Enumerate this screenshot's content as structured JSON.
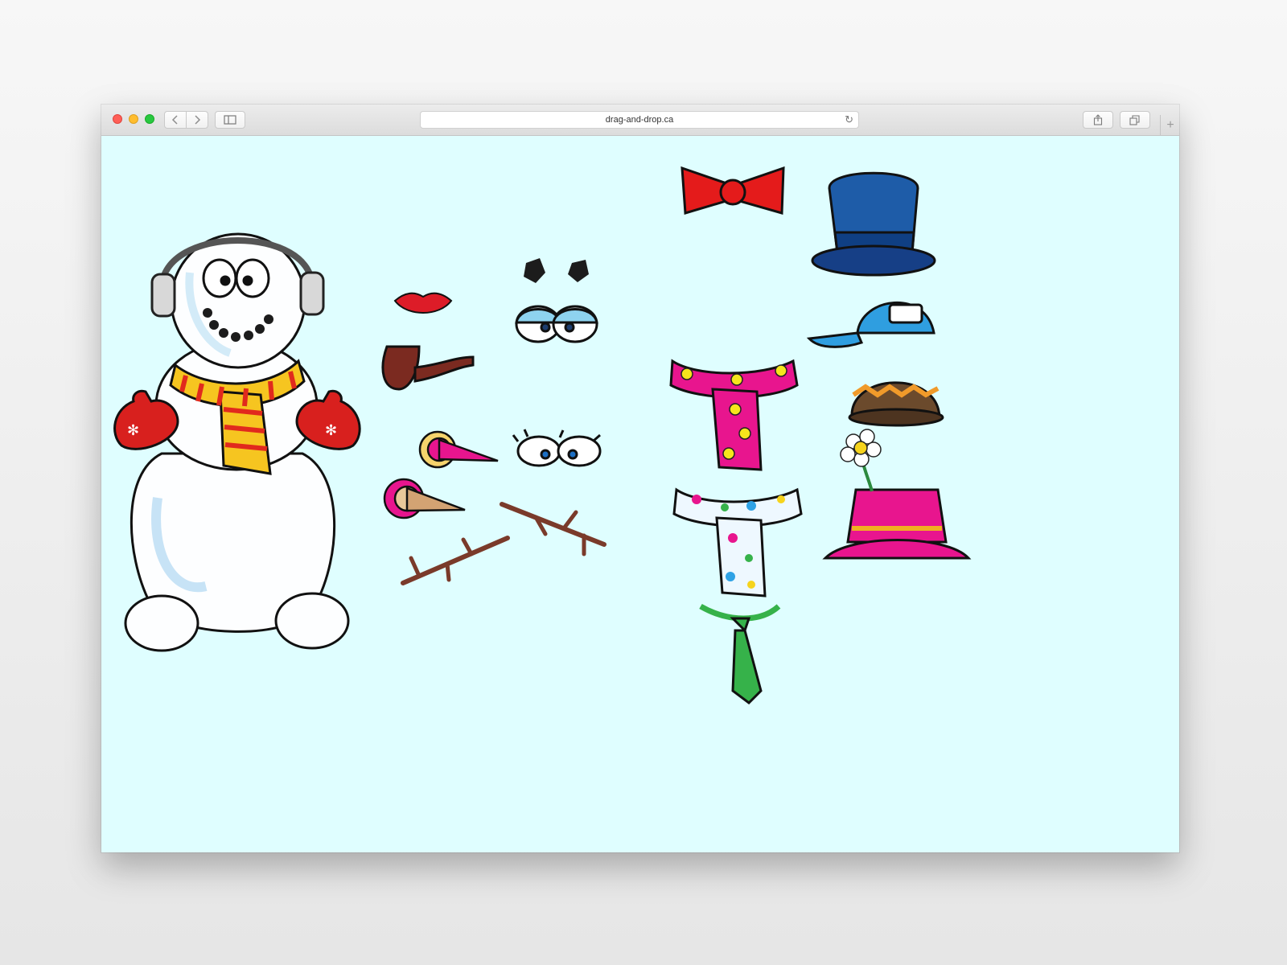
{
  "browser": {
    "url": "drag-and-drop.ca",
    "icons": {
      "back": "chevron-left-icon",
      "forward": "chevron-right-icon",
      "sidebar": "sidebar-icon",
      "reload": "reload-icon",
      "share": "share-icon",
      "tabs": "tabs-icon",
      "new_tab": "plus-icon"
    }
  },
  "canvas": {
    "background": "#dffeff",
    "snowman": {
      "accessories": [
        "headphones",
        "scarf",
        "mittens",
        "coal-smile"
      ]
    },
    "parts": [
      "lips",
      "coal-eyes",
      "sleepy-eyes",
      "pipe",
      "pink-carrot-nose",
      "lash-eyes",
      "cone-nose",
      "stick-arm-left",
      "stick-arm-right",
      "bow-tie",
      "pink-flower-scarf",
      "polka-dot-scarf",
      "green-tie",
      "top-hat",
      "baseball-cap",
      "knit-beanie",
      "flower-bucket-hat"
    ]
  },
  "colors": {
    "accent_red": "#e41b1b",
    "hat_blue": "#1e5ca8",
    "cap_blue": "#2f9ee0",
    "pink": "#e8158e",
    "green": "#36b24a"
  }
}
